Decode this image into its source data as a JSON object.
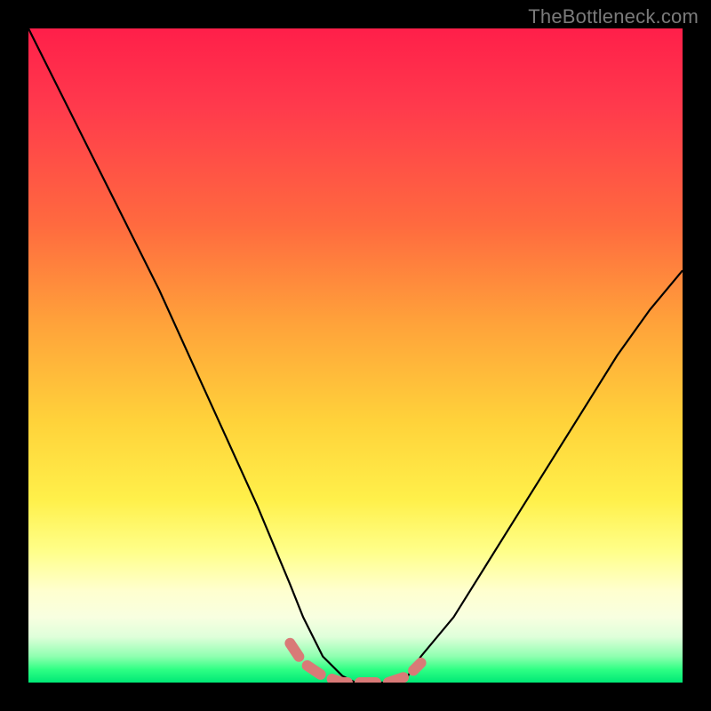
{
  "watermark": "TheBottleneck.com",
  "chart_data": {
    "type": "line",
    "title": "",
    "xlabel": "",
    "ylabel": "",
    "xlim": [
      0,
      100
    ],
    "ylim": [
      0,
      100
    ],
    "series": [
      {
        "name": "bottleneck-curve",
        "x": [
          0,
          5,
          10,
          15,
          20,
          25,
          30,
          35,
          40,
          42,
          45,
          48,
          50,
          52,
          55,
          58,
          60,
          65,
          70,
          75,
          80,
          85,
          90,
          95,
          100
        ],
        "values": [
          100,
          90,
          80,
          70,
          60,
          49,
          38,
          27,
          15,
          10,
          4,
          1,
          0,
          0,
          0,
          1,
          4,
          10,
          18,
          26,
          34,
          42,
          50,
          57,
          63
        ]
      },
      {
        "name": "optimal-band-marker",
        "x": [
          40,
          42,
          45,
          48,
          50,
          52,
          55,
          58,
          60
        ],
        "values": [
          6,
          3,
          1,
          0,
          0,
          0,
          0,
          1,
          3
        ]
      }
    ],
    "gradient_meaning": "vertical color = bottleneck severity (red high, green low)",
    "annotations": []
  },
  "colors": {
    "curve": "#000000",
    "marker": "#d97a77",
    "frame": "#000000"
  }
}
